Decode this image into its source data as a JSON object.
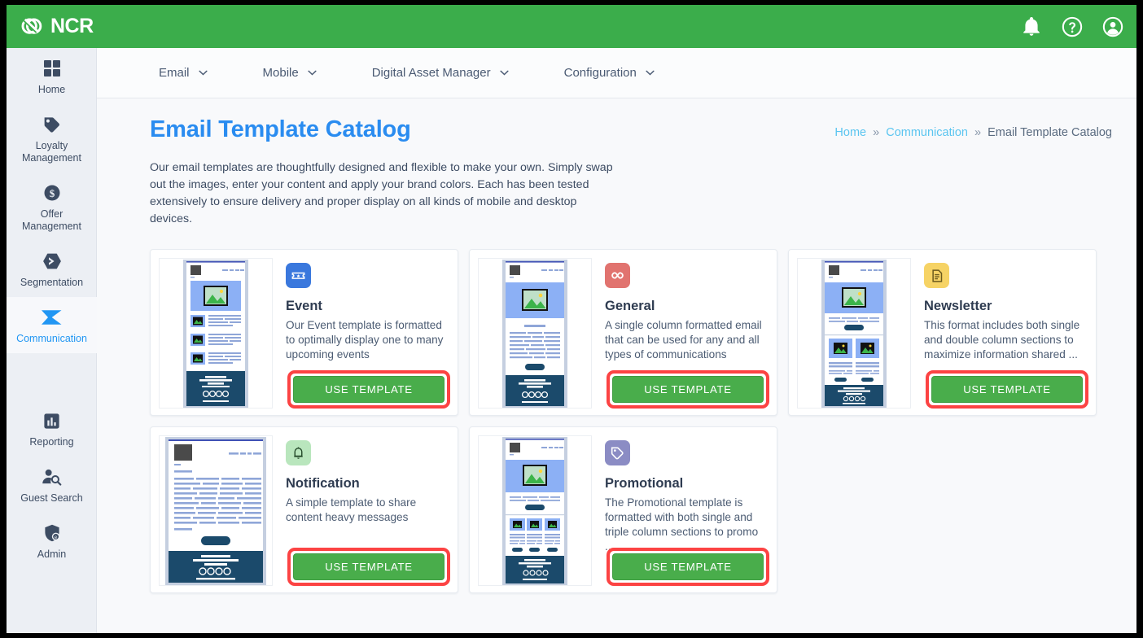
{
  "header": {
    "brand": "NCR",
    "brand_color": "#3bad4b",
    "icons": [
      {
        "name": "notifications-icon",
        "label": "Notifications"
      },
      {
        "name": "help-icon",
        "label": "Help"
      },
      {
        "name": "account-icon",
        "label": "Account"
      }
    ]
  },
  "sidebar": {
    "items": [
      {
        "label": "Home",
        "icon": "grid-icon",
        "active": false
      },
      {
        "label": "Loyalty Management",
        "icon": "tag-icon",
        "active": false
      },
      {
        "label": "Offer Management",
        "icon": "dollar-coin-icon",
        "active": false
      },
      {
        "label": "Segmentation",
        "icon": "send-arrow-icon",
        "active": false
      },
      {
        "label": "Communication",
        "icon": "paper-plane-icon",
        "active": true
      },
      {
        "label": "Reporting",
        "icon": "bar-chart-icon",
        "active": false
      },
      {
        "label": "Guest Search",
        "icon": "person-search-icon",
        "active": false
      },
      {
        "label": "Admin",
        "icon": "admin-shield-icon",
        "active": false
      }
    ]
  },
  "navbar": {
    "items": [
      {
        "label": "Email"
      },
      {
        "label": "Mobile"
      },
      {
        "label": "Digital Asset Manager"
      },
      {
        "label": "Configuration"
      }
    ]
  },
  "page": {
    "title": "Email Template Catalog",
    "title_color": "#2a8cf0",
    "intro": "Our email templates are thoughtfully designed and flexible to make your own. Simply swap out the images, enter your content and apply your brand colors. Each has been tested extensively to ensure delivery and proper display on all kinds of mobile and desktop devices."
  },
  "breadcrumb": {
    "home": "Home",
    "section": "Communication",
    "current": "Email Template Catalog",
    "separator": "»"
  },
  "cards": [
    {
      "title": "Event",
      "description": "Our Event template is formatted to optimally display one to many upcoming events",
      "icon": "ticket-icon",
      "icon_bg": "#3a78dd",
      "icon_fg": "#ffffff",
      "button_label": "USE TEMPLATE",
      "thumb": "event",
      "highlighted": true
    },
    {
      "title": "General",
      "description": "A single column formatted email that can be used for any and all types of communications",
      "icon": "infinity-icon",
      "icon_bg": "#e1736f",
      "icon_fg": "#ffffff",
      "button_label": "USE TEMPLATE",
      "thumb": "general",
      "highlighted": true
    },
    {
      "title": "Newsletter",
      "description": "This format includes both single and double column sections to maximize information shared ...",
      "icon": "document-icon",
      "icon_bg": "#f6d365",
      "icon_fg": "#6b5a1e",
      "button_label": "USE TEMPLATE",
      "thumb": "newsletter",
      "highlighted": true
    },
    {
      "title": "Notification",
      "description": "A simple template to share content heavy messages",
      "icon": "bell-icon",
      "icon_bg": "#b9e6bd",
      "icon_fg": "#24492a",
      "button_label": "USE TEMPLATE",
      "thumb": "notification",
      "highlighted": true
    },
    {
      "title": "Promotional",
      "description": "The Promotional template is formatted with both single and triple column sections to promo ...",
      "icon": "price-tag-icon",
      "icon_bg": "#8b8cc4",
      "icon_fg": "#ffffff",
      "button_label": "USE TEMPLATE",
      "thumb": "promotional",
      "highlighted": true
    }
  ],
  "colors": {
    "accent_green": "#3bad4b",
    "button_green": "#49ad4b",
    "highlight_red": "#fc4343",
    "link_blue": "#5bc5f0",
    "title_blue": "#2a8cf0"
  }
}
